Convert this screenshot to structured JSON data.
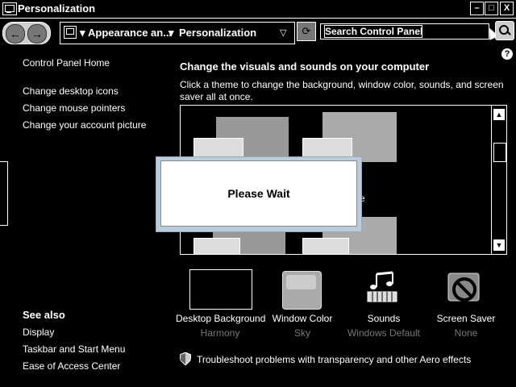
{
  "window": {
    "title": "Personalization",
    "min_label": "–",
    "max_label": "□",
    "close_label": "X"
  },
  "address": {
    "crumb1": "Appearance an...",
    "crumb2": "Personalization",
    "dropdown_glyph": "▽"
  },
  "search": {
    "placeholder": "Search Control Panel"
  },
  "help_glyph": "?",
  "sidebar": {
    "home": "Control Panel Home",
    "links": [
      "Change desktop icons",
      "Change mouse pointers",
      "Change your account picture"
    ],
    "see_also": "See also",
    "see_also_links": [
      "Display",
      "Taskbar and Start Menu",
      "Ease of Access Center"
    ]
  },
  "main": {
    "title": "Change the visuals and sounds on your computer",
    "description": "Click a theme to change the background, window color, sounds, and screen saver all at once.",
    "theme_caption": "cture"
  },
  "dialog": {
    "text": "Please Wait"
  },
  "items": [
    {
      "label": "Desktop Background",
      "value": "Harmony"
    },
    {
      "label": "Window Color",
      "value": "Sky"
    },
    {
      "label": "Sounds",
      "value": "Windows Default"
    },
    {
      "label": "Screen Saver",
      "value": "None"
    }
  ],
  "troubleshoot": "Troubleshoot problems with transparency and other Aero effects",
  "colors": {
    "background": "#000000",
    "text": "#ffffff",
    "subtext": "#777777"
  },
  "icons": [
    "window-icon",
    "back-icon",
    "forward-icon",
    "refresh-icon",
    "search-icon",
    "help-icon",
    "shield-icon",
    "music-notes-icon",
    "no-sign-icon"
  ]
}
